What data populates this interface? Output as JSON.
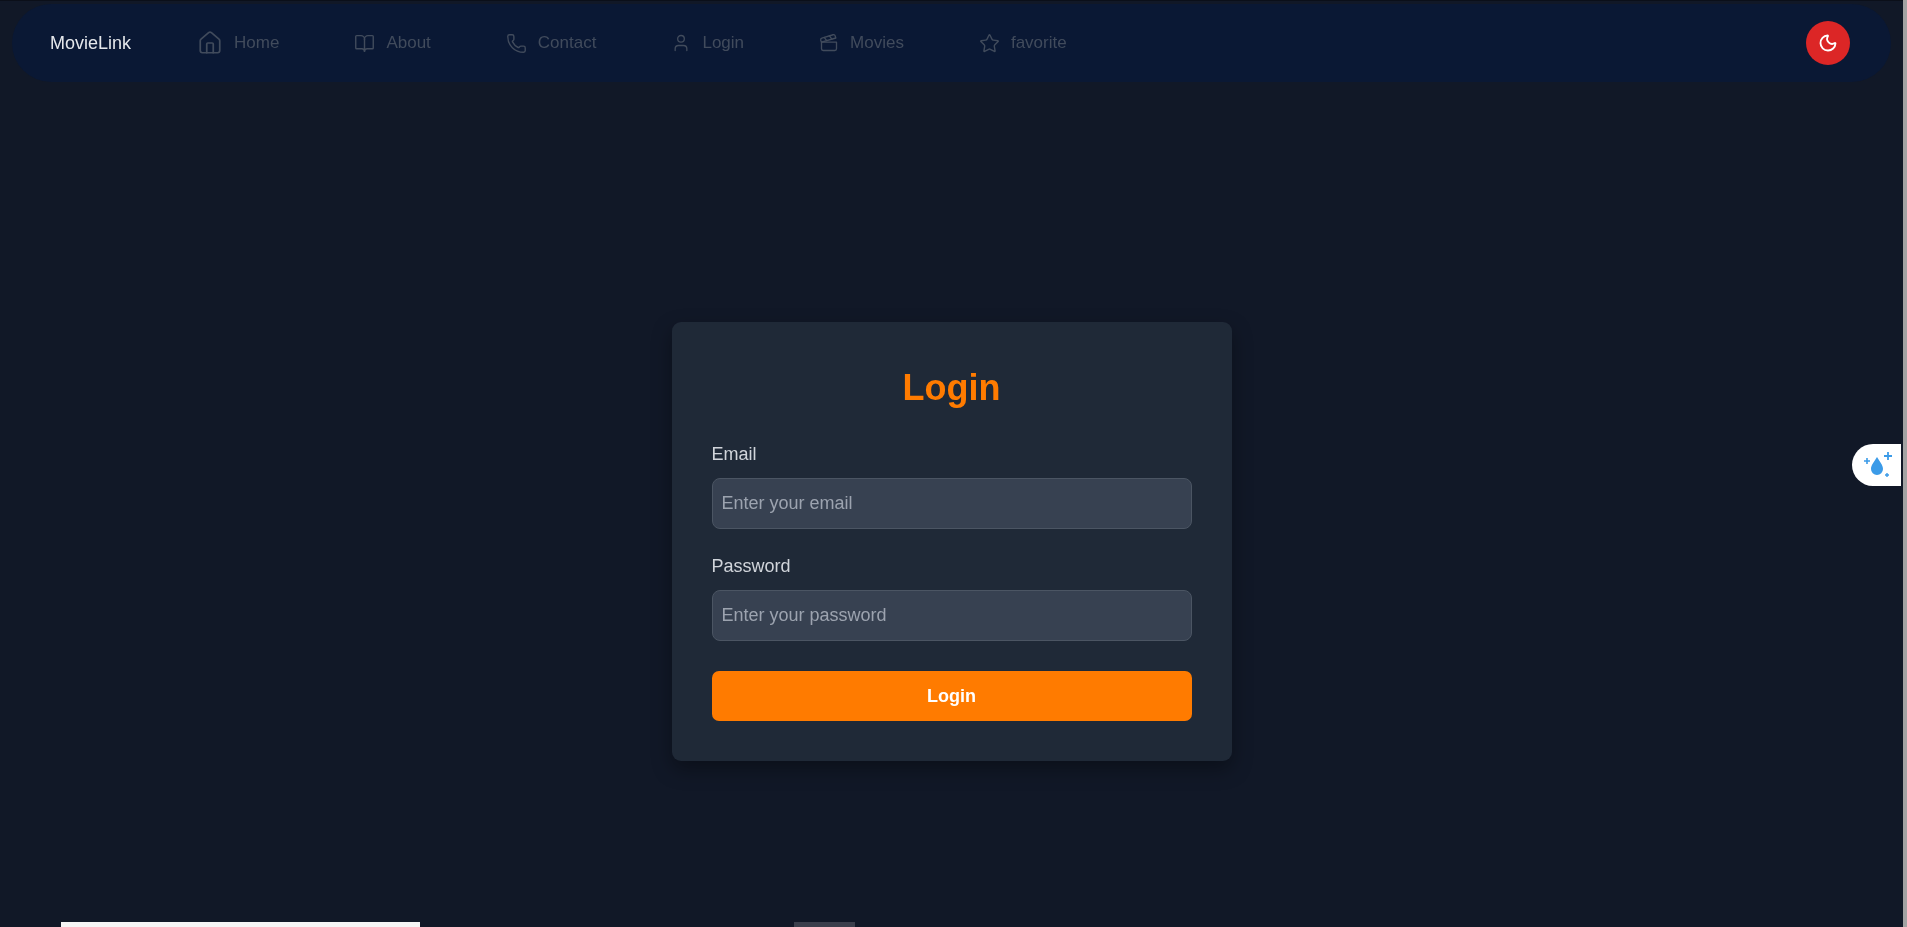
{
  "nav": {
    "brand": "MovieLink",
    "items": [
      {
        "label": "Home"
      },
      {
        "label": "About"
      },
      {
        "label": "Contact"
      },
      {
        "label": "Login"
      },
      {
        "label": "Movies"
      },
      {
        "label": "favorite"
      }
    ]
  },
  "login_form": {
    "title": "Login",
    "fields": [
      {
        "label": "Email",
        "placeholder": "Enter your email"
      },
      {
        "label": "Password",
        "placeholder": "Enter your password"
      }
    ],
    "submit_button": "Login"
  }
}
